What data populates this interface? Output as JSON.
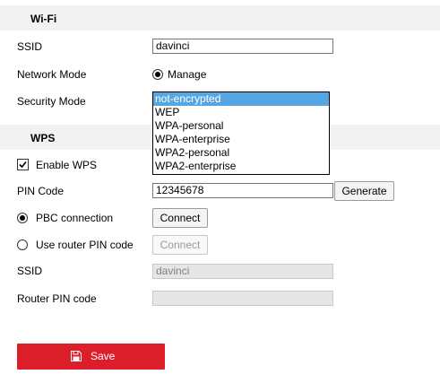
{
  "wifi": {
    "title": "Wi-Fi",
    "ssid_label": "SSID",
    "ssid_value": "davinci",
    "network_mode_label": "Network Mode",
    "network_mode_option": "Manage",
    "security_mode_label": "Security Mode",
    "security_mode_options": [
      "not-encrypted",
      "WEP",
      "WPA-personal",
      "WPA-enterprise",
      "WPA2-personal",
      "WPA2-enterprise"
    ],
    "security_mode_selected": "not-encrypted"
  },
  "wps": {
    "title": "WPS",
    "enable_label": "Enable WPS",
    "enable_checked": true,
    "pin_code_label": "PIN Code",
    "pin_code_value": "12345678",
    "generate_label": "Generate",
    "pbc_label": "PBC connection",
    "pbc_selected": true,
    "connect_label": "Connect",
    "router_pin_label": "Use router PIN code",
    "connect_disabled_label": "Connect",
    "ssid_label": "SSID",
    "ssid_value": "davinci",
    "router_pin_code_label": "Router PIN code",
    "router_pin_code_value": ""
  },
  "save": {
    "label": "Save",
    "icon": "floppy-disk-icon",
    "color": "#dc1e2b"
  }
}
